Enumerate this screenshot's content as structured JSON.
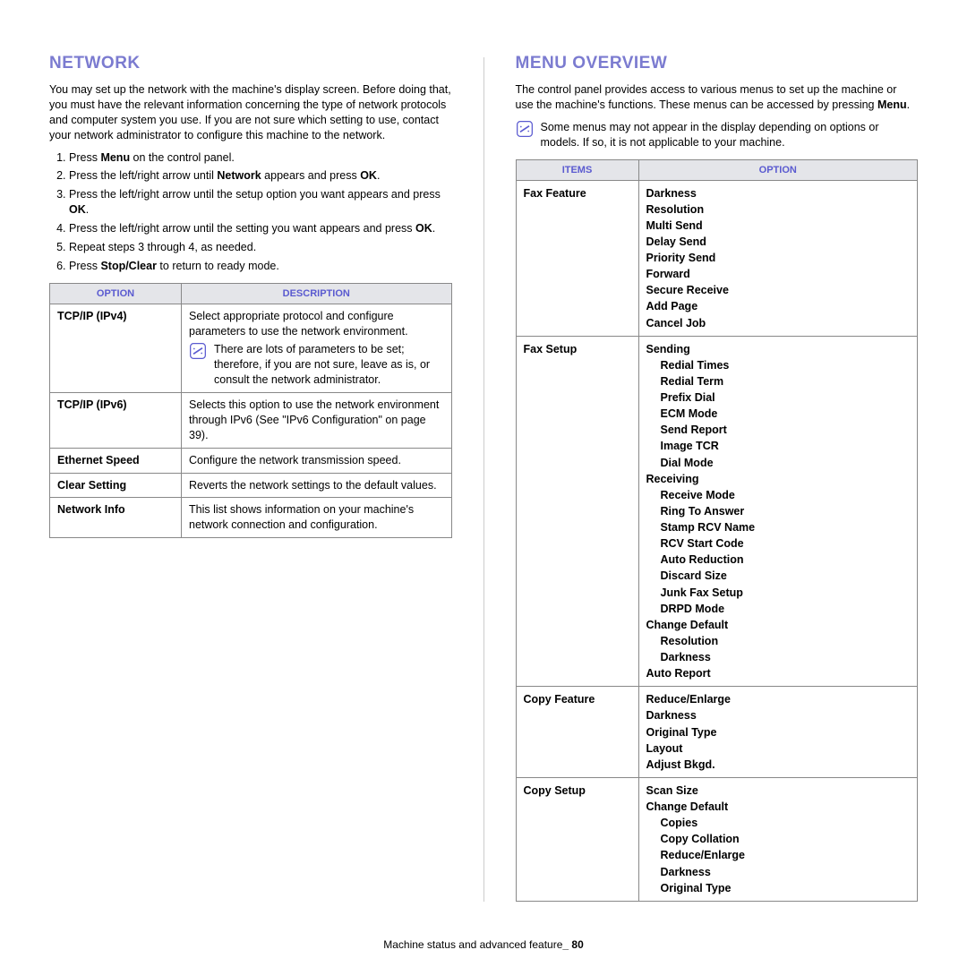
{
  "left": {
    "title": "NETWORK",
    "intro": "You may set up the network with the machine's display screen. Before doing that, you must have the relevant information concerning the type of network protocols and computer system you use. If you are not sure which setting to use, contact your network administrator to configure this machine to the network.",
    "steps": {
      "s1a": "Press ",
      "s1b": "Menu",
      "s1c": " on the control panel.",
      "s2a": "Press the left/right arrow until ",
      "s2b": "Network",
      "s2c": " appears and press ",
      "s2d": "OK",
      "s2e": ".",
      "s3a": "Press the left/right arrow until the setup option you want appears and press ",
      "s3b": "OK",
      "s3c": ".",
      "s4a": "Press the left/right arrow until the setting you want appears and press ",
      "s4b": "OK",
      "s4c": ".",
      "s5": "Repeat steps 3 through 4, as needed.",
      "s6a": "Press ",
      "s6b": "Stop/Clear",
      "s6c": " to return to ready mode."
    },
    "table": {
      "h1": "OPTION",
      "h2": "DESCRIPTION",
      "r1o": "TCP/IP (IPv4)",
      "r1d": "Select appropriate protocol and configure parameters to use the network environment.",
      "r1note": "There are lots of parameters to be set; therefore, if you are not sure, leave as is, or consult the network administrator.",
      "r2o": "TCP/IP (IPv6)",
      "r2d": "Selects this option to use the network environment through IPv6 (See \"IPv6 Configuration\" on page 39).",
      "r3o": "Ethernet Speed",
      "r3d": "Configure the network transmission speed.",
      "r4o": "Clear Setting",
      "r4d": "Reverts the network settings to the default values.",
      "r5o": "Network Info",
      "r5d": "This list shows information on your machine's network connection and configuration."
    }
  },
  "right": {
    "title": "MENU OVERVIEW",
    "intro1": "The control panel provides access to various menus to set up the machine or use the machine's functions. These menus can be accessed by pressing ",
    "intro2": "Menu",
    "intro3": ".",
    "note": "Some menus may not appear in the display depending on options or models. If so, it is not applicable to your machine.",
    "th1": "ITEMS",
    "th2": "OPTION",
    "r1i": "Fax Feature",
    "r1": [
      "Darkness",
      "Resolution",
      "Multi Send",
      "Delay Send",
      "Priority Send",
      "Forward",
      "Secure Receive",
      "Add Page",
      "Cancel Job"
    ],
    "r2i": "Fax Setup",
    "r2_send": "Sending",
    "r2_send_sub": [
      "Redial Times",
      "Redial Term",
      "Prefix Dial",
      "ECM Mode",
      "Send Report",
      "Image TCR",
      "Dial Mode"
    ],
    "r2_recv": "Receiving",
    "r2_recv_sub": [
      "Receive Mode",
      "Ring To Answer",
      "Stamp RCV Name",
      "RCV Start Code",
      "Auto Reduction",
      "Discard Size",
      "Junk Fax Setup",
      "DRPD Mode"
    ],
    "r2_cd": "Change Default",
    "r2_cd_sub": [
      "Resolution",
      "Darkness"
    ],
    "r2_ar": "Auto Report",
    "r3i": "Copy Feature",
    "r3": [
      "Reduce/Enlarge",
      "Darkness",
      "Original Type",
      "Layout",
      "Adjust Bkgd."
    ],
    "r4i": "Copy Setup",
    "r4_ss": "Scan Size",
    "r4_cd": "Change Default",
    "r4_cd_sub": [
      "Copies",
      "Copy Collation",
      "Reduce/Enlarge",
      "Darkness",
      "Original Type"
    ]
  },
  "footer": {
    "text": "Machine status and advanced feature",
    "page": "80"
  }
}
